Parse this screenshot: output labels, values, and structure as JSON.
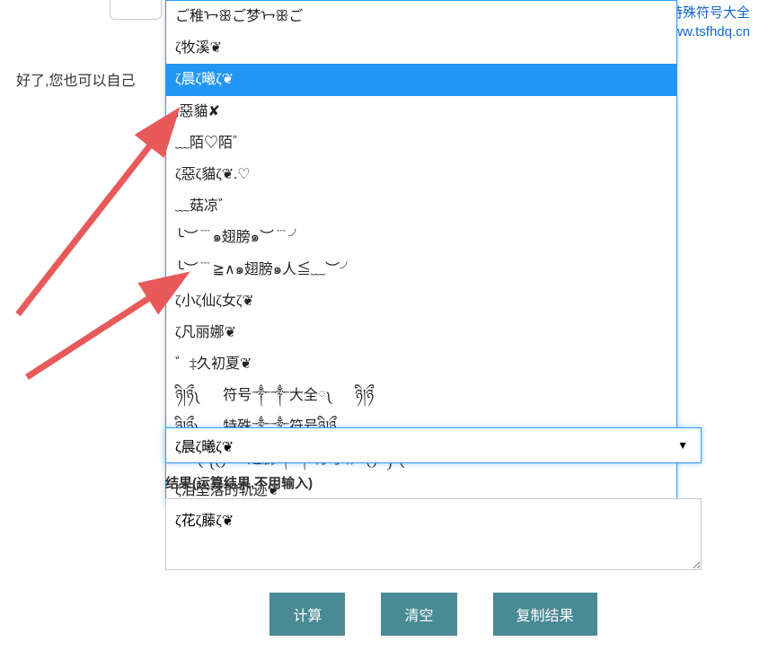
{
  "watermark": {
    "line1": "特殊符号大全",
    "line2": "www.tsfhdq.cn"
  },
  "instruction": "好了,您也可以自己",
  "dropdown": {
    "items": [
      {
        "text": "ご稚ᢇꕥご梦ᢇꕥご",
        "selected": false
      },
      {
        "text": "ζ牧溪❦",
        "selected": false
      },
      {
        "text": "ζ晨ζ曦ζ❦",
        "selected": true
      },
      {
        "text": ";惡貓✘",
        "selected": false
      },
      {
        "text": "﹏陌♡陌゛",
        "selected": false
      },
      {
        "text": "ζ惡ζ貓ζ❦.♡",
        "selected": false
      },
      {
        "text": "﹏菇凉゛",
        "selected": false
      },
      {
        "text": "╰︶﹉๑翅膀๑︶﹉╯",
        "selected": false
      },
      {
        "text": "╰︶﹉≧∧๑翅膀๑人≦﹏︶╯",
        "selected": false
      },
      {
        "text": "ζ小ζ仙ζ女ζ❦",
        "selected": false
      },
      {
        "text": "ζ凡丽娜❦",
        "selected": false
      },
      {
        "text": "゛‡久初夏❦",
        "selected": false
      },
      {
        "text": "ཉི།ཉྀ༾❀༿符号༒༒大全༾❀༿ཉི།ཉྀ",
        "selected": false
      },
      {
        "text": "ཉི།ཉྀ༾❀༿特殊༒༒符号ཉི།ཉྀ",
        "selected": false
      },
      {
        "text": "ᰔᩚ༾༽༾༿❀翅膀༒༒符号❀༾༿༼༾ᰔᩚ",
        "selected": false
      },
      {
        "text": "ζ泪坠落的轨迹❦",
        "selected": false
      }
    ],
    "selectedValue": "ζ晨ζ曦ζ❦"
  },
  "result": {
    "label": "结果(运算结果,不用输入)",
    "value": "ζ花ζ藤ζ❦"
  },
  "buttons": {
    "calc": "计算",
    "clear": "清空",
    "copy": "复制结果"
  }
}
